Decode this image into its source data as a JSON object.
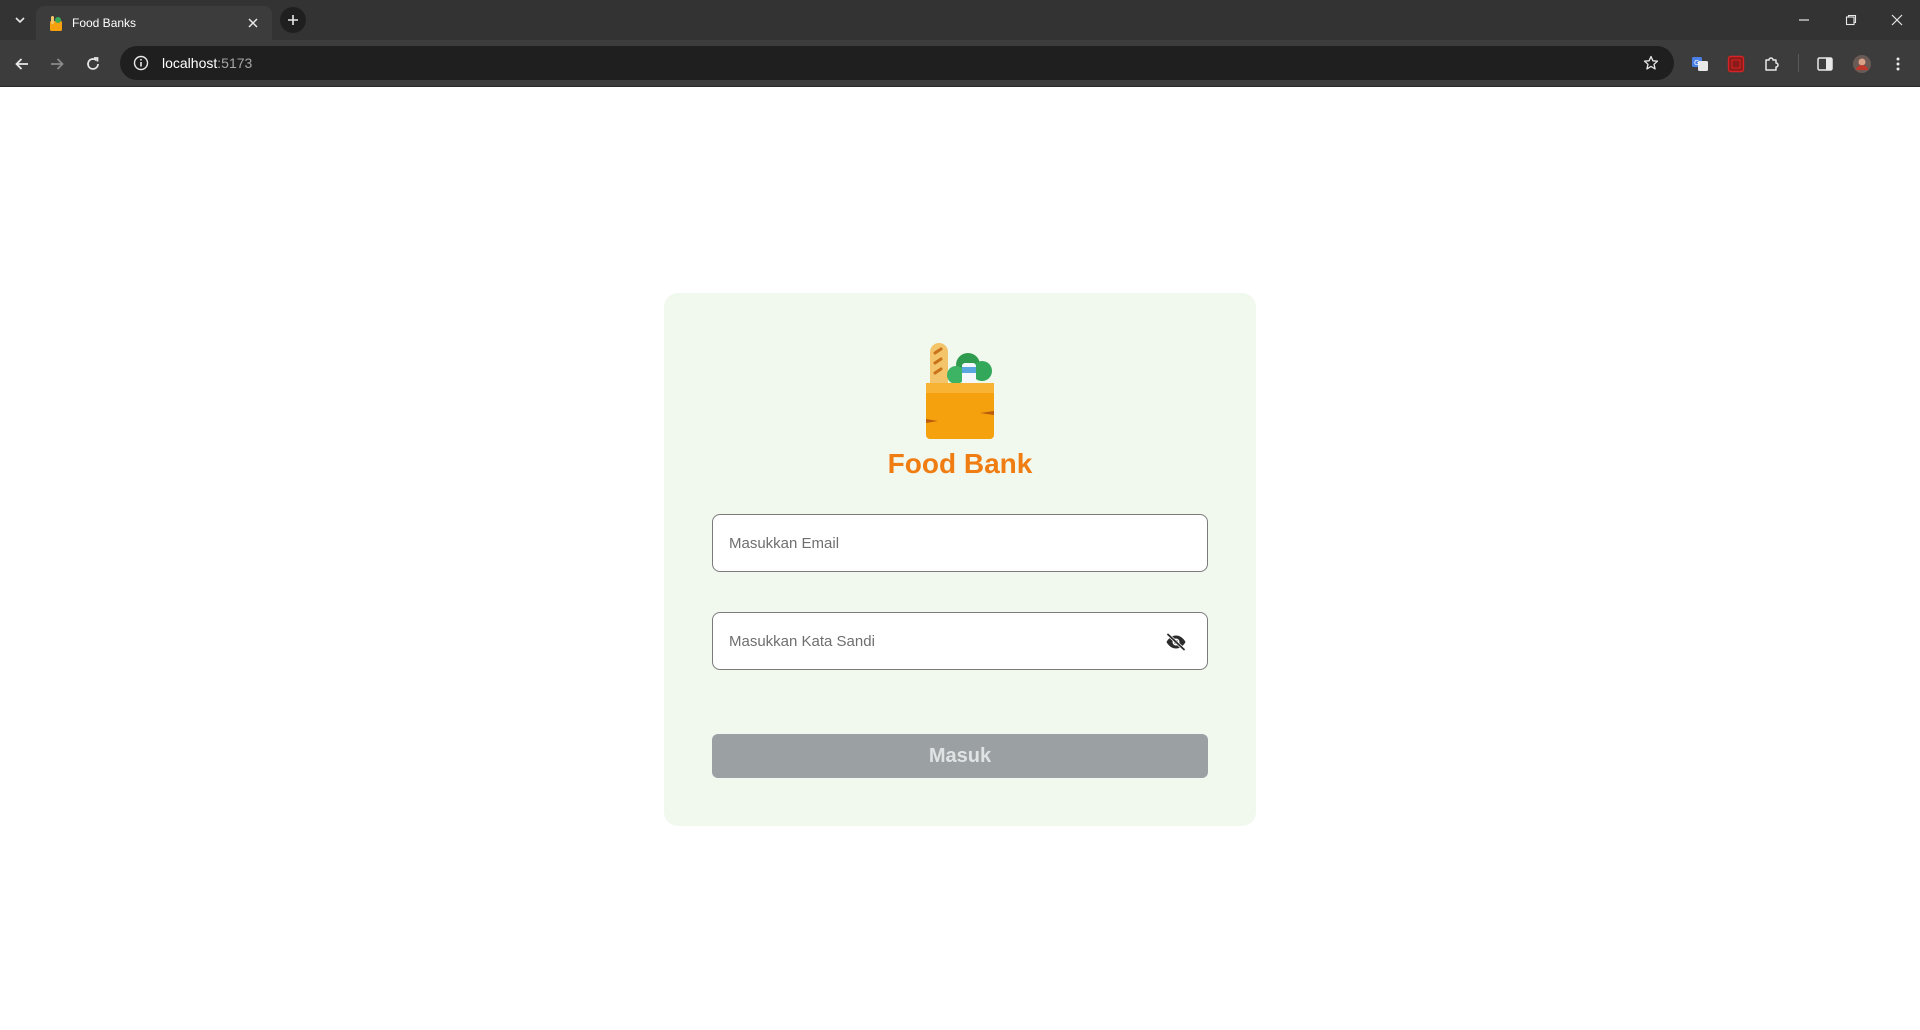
{
  "browser": {
    "tab": {
      "title": "Food Banks"
    },
    "omnibox": {
      "host": "localhost",
      "port": ":5173"
    },
    "icons": {
      "tab_search": "chevron-down-icon",
      "tab_close": "close-icon",
      "new_tab": "plus-icon",
      "back": "arrow-left-icon",
      "forward": "arrow-right-icon",
      "reload": "reload-icon",
      "site_info": "info-icon",
      "bookmark": "star-icon",
      "translate": "translate-icon",
      "extension_red": "red-square-icon",
      "extensions": "puzzle-icon",
      "side_panel": "side-panel-icon",
      "profile": "avatar-icon",
      "menu": "kebab-menu-icon",
      "minimize": "minimize-icon",
      "maximize": "restore-icon",
      "close": "close-icon"
    }
  },
  "login": {
    "brand": "Food Bank",
    "email_placeholder": "Masukkan Email",
    "password_placeholder": "Masukkan Kata Sandi",
    "submit_label": "Masuk",
    "logo_icon": "grocery-bag-icon",
    "password_toggle_icon": "eye-off-icon"
  },
  "colors": {
    "brand": "#f07d12",
    "card_bg": "#f1f8ee",
    "button_disabled": "#9ba1a3"
  }
}
